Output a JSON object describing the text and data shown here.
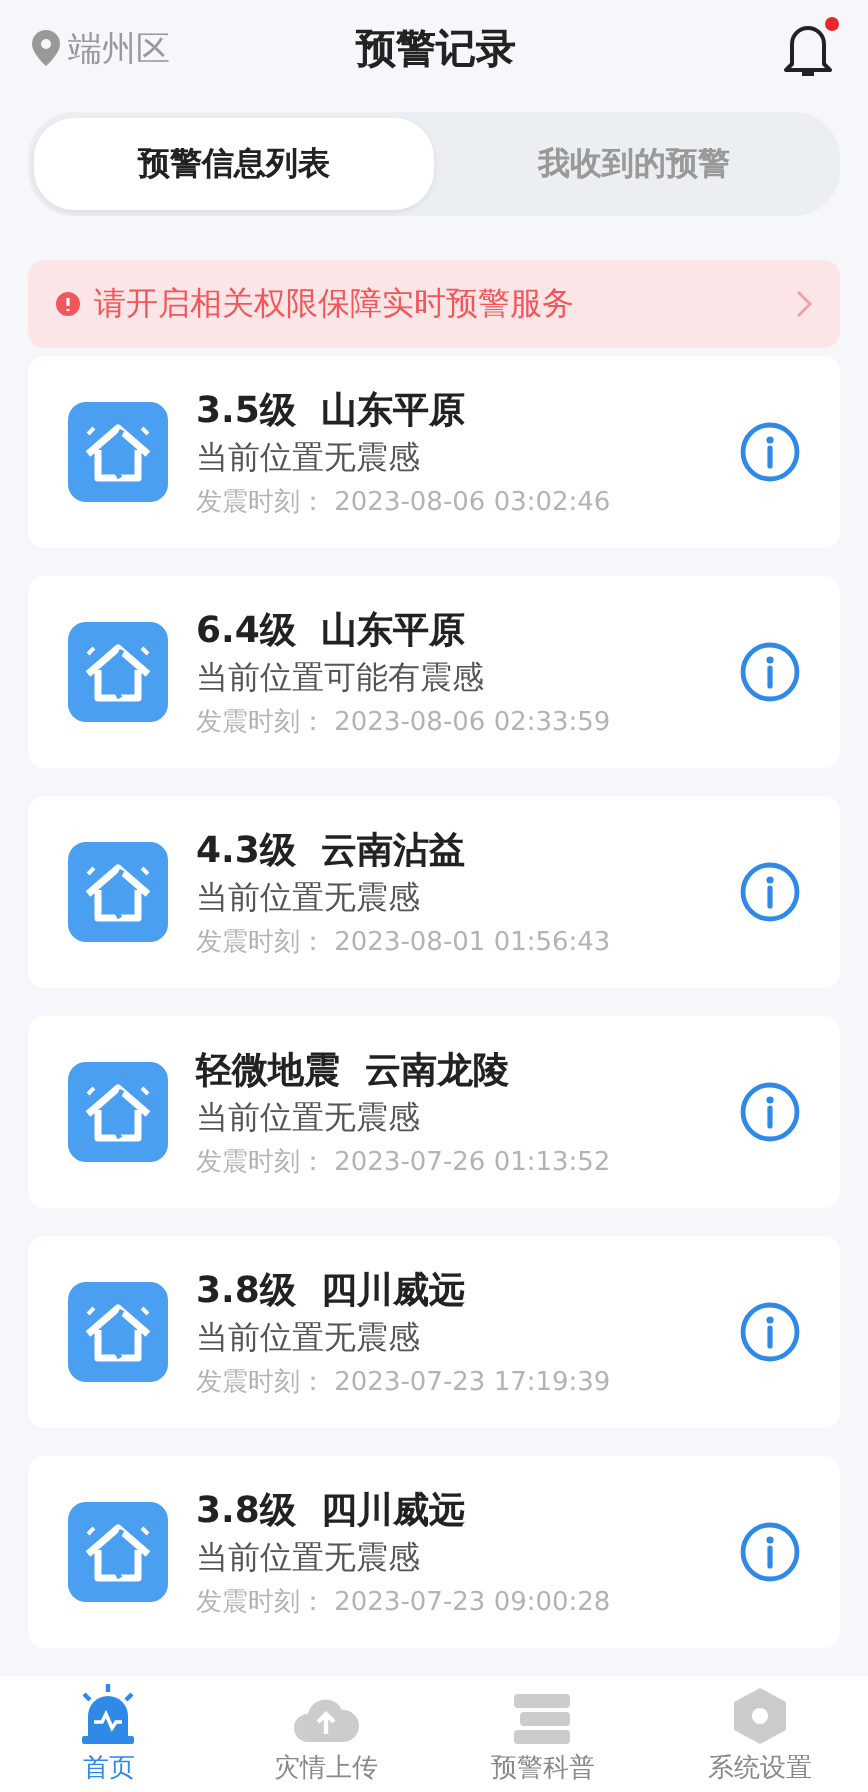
{
  "header": {
    "location": "端州区",
    "title": "预警记录",
    "has_notification": true
  },
  "tabs": [
    {
      "label": "预警信息列表",
      "selected": true
    },
    {
      "label": "我收到的预警",
      "selected": false
    }
  ],
  "banner": {
    "text": "请开启相关权限保障实时预警服务"
  },
  "records": [
    {
      "magnitude": "3.5级",
      "place": "山东平原",
      "felt": "当前位置无震感",
      "time_label": "发震时刻：",
      "time": "2023-08-06 03:02:46"
    },
    {
      "magnitude": "6.4级",
      "place": "山东平原",
      "felt": "当前位置可能有震感",
      "time_label": "发震时刻：",
      "time": "2023-08-06 02:33:59"
    },
    {
      "magnitude": "4.3级",
      "place": "云南沾益",
      "felt": "当前位置无震感",
      "time_label": "发震时刻：",
      "time": "2023-08-01 01:56:43"
    },
    {
      "magnitude": "轻微地震",
      "place": "云南龙陵",
      "felt": "当前位置无震感",
      "time_label": "发震时刻：",
      "time": "2023-07-26 01:13:52"
    },
    {
      "magnitude": "3.8级",
      "place": "四川威远",
      "felt": "当前位置无震感",
      "time_label": "发震时刻：",
      "time": "2023-07-23 17:19:39"
    },
    {
      "magnitude": "3.8级",
      "place": "四川威远",
      "felt": "当前位置无震感",
      "time_label": "发震时刻：",
      "time": "2023-07-23 09:00:28"
    }
  ],
  "nav": [
    {
      "kind": "alarm",
      "label": "首页",
      "selected": true
    },
    {
      "kind": "upload",
      "label": "灾情上传",
      "selected": false
    },
    {
      "kind": "book",
      "label": "预警科普",
      "selected": false
    },
    {
      "kind": "settings",
      "label": "系统设置",
      "selected": false
    }
  ]
}
